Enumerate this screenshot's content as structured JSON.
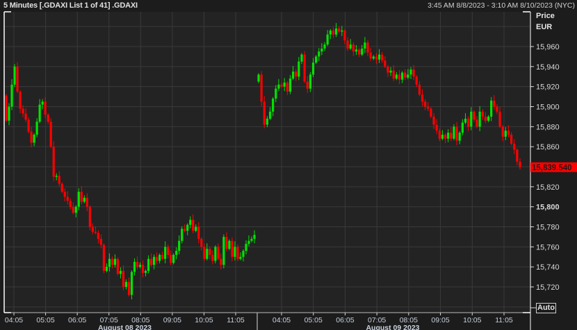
{
  "header": {
    "title": "5 Minutes [.GDAXI List 1 of 41] .GDAXI",
    "range": "3:45 AM 8/8/2023 - 3:10 AM 8/10/2023 (NYC)"
  },
  "axis_header": {
    "price": "Price",
    "currency": "EUR"
  },
  "auto_button": "Auto",
  "colors": {
    "up": "#00e400",
    "down": "#ff0000",
    "background": "#232323",
    "grid": "#3a3a3a",
    "last_price_bg": "#ff0000"
  },
  "chart_data": {
    "type": "candlestick",
    "title": "5 Minutes [.GDAXI List 1 of 41] .GDAXI",
    "ylabel": "Price EUR",
    "ylim": [
      15694,
      15993
    ],
    "y_ticks": [
      15720,
      15740,
      15760,
      15780,
      15800,
      15820,
      15840,
      15860,
      15880,
      15900,
      15920,
      15940,
      15960
    ],
    "y_tick_labels": [
      "15,720",
      "15,740",
      "15,760",
      "15,780",
      "15,800",
      "15,820",
      "15,840",
      "15,860",
      "15,880",
      "15,900",
      "15,920",
      "15,940",
      "15,960"
    ],
    "y_bold_tick": "15,800",
    "last_price": "15,839.540",
    "last_price_value": 15839.54,
    "grid": true,
    "days": [
      {
        "label": "August 08 2023",
        "x_tick_labels": [
          "04:05",
          "05:05",
          "06:05",
          "07:05",
          "08:05",
          "09:05",
          "10:05",
          "11:05"
        ],
        "open": 15911,
        "closes": [
          15886,
          15900,
          15922,
          15940,
          15915,
          15898,
          15893,
          15887,
          15875,
          15864,
          15872,
          15885,
          15902,
          15905,
          15892,
          15885,
          15860,
          15830,
          15831,
          15823,
          15815,
          15810,
          15806,
          15800,
          15794,
          15800,
          15815,
          15805,
          15809,
          15800,
          15780,
          15775,
          15774,
          15768,
          15762,
          15736,
          15740,
          15748,
          15742,
          15748,
          15733,
          15736,
          15720,
          15725,
          15712,
          15735,
          15745,
          15740,
          15742,
          15734,
          15736,
          15748,
          15742,
          15750,
          15746,
          15752,
          15748,
          15760,
          15752,
          15744,
          15752,
          15756,
          15766,
          15778,
          15776,
          15782,
          15787,
          15776,
          15780,
          15768,
          15760,
          15748,
          15758,
          15752,
          15746,
          15760,
          15748,
          15742,
          15770,
          15758,
          15766,
          15750,
          15760,
          15748,
          15750,
          15756,
          15763,
          15766,
          15768,
          15772
        ]
      },
      {
        "label": "August 09 2023",
        "x_tick_labels": [
          "04:05",
          "05:05",
          "06:05",
          "07:05",
          "08:05",
          "09:05",
          "10:05",
          "11:05"
        ],
        "open": 15925,
        "closes": [
          15932,
          15905,
          15882,
          15888,
          15895,
          15908,
          15918,
          15922,
          15920,
          15924,
          15915,
          15928,
          15935,
          15930,
          15945,
          15952,
          15925,
          15918,
          15932,
          15944,
          15950,
          15955,
          15958,
          15962,
          15972,
          15976,
          15972,
          15978,
          15975,
          15976,
          15966,
          15958,
          15962,
          15955,
          15957,
          15952,
          15958,
          15964,
          15954,
          15948,
          15950,
          15947,
          15952,
          15946,
          15940,
          15934,
          15936,
          15928,
          15932,
          15927,
          15934,
          15929,
          15932,
          15937,
          15930,
          15922,
          15912,
          15905,
          15900,
          15898,
          15890,
          15882,
          15876,
          15868,
          15872,
          15868,
          15874,
          15868,
          15880,
          15866,
          15874,
          15884,
          15888,
          15880,
          15895,
          15887,
          15880,
          15895,
          15890,
          15886,
          15890,
          15906,
          15900,
          15895,
          15880,
          15870,
          15876,
          15872,
          15863,
          15857,
          15845,
          15839.54
        ]
      }
    ]
  }
}
